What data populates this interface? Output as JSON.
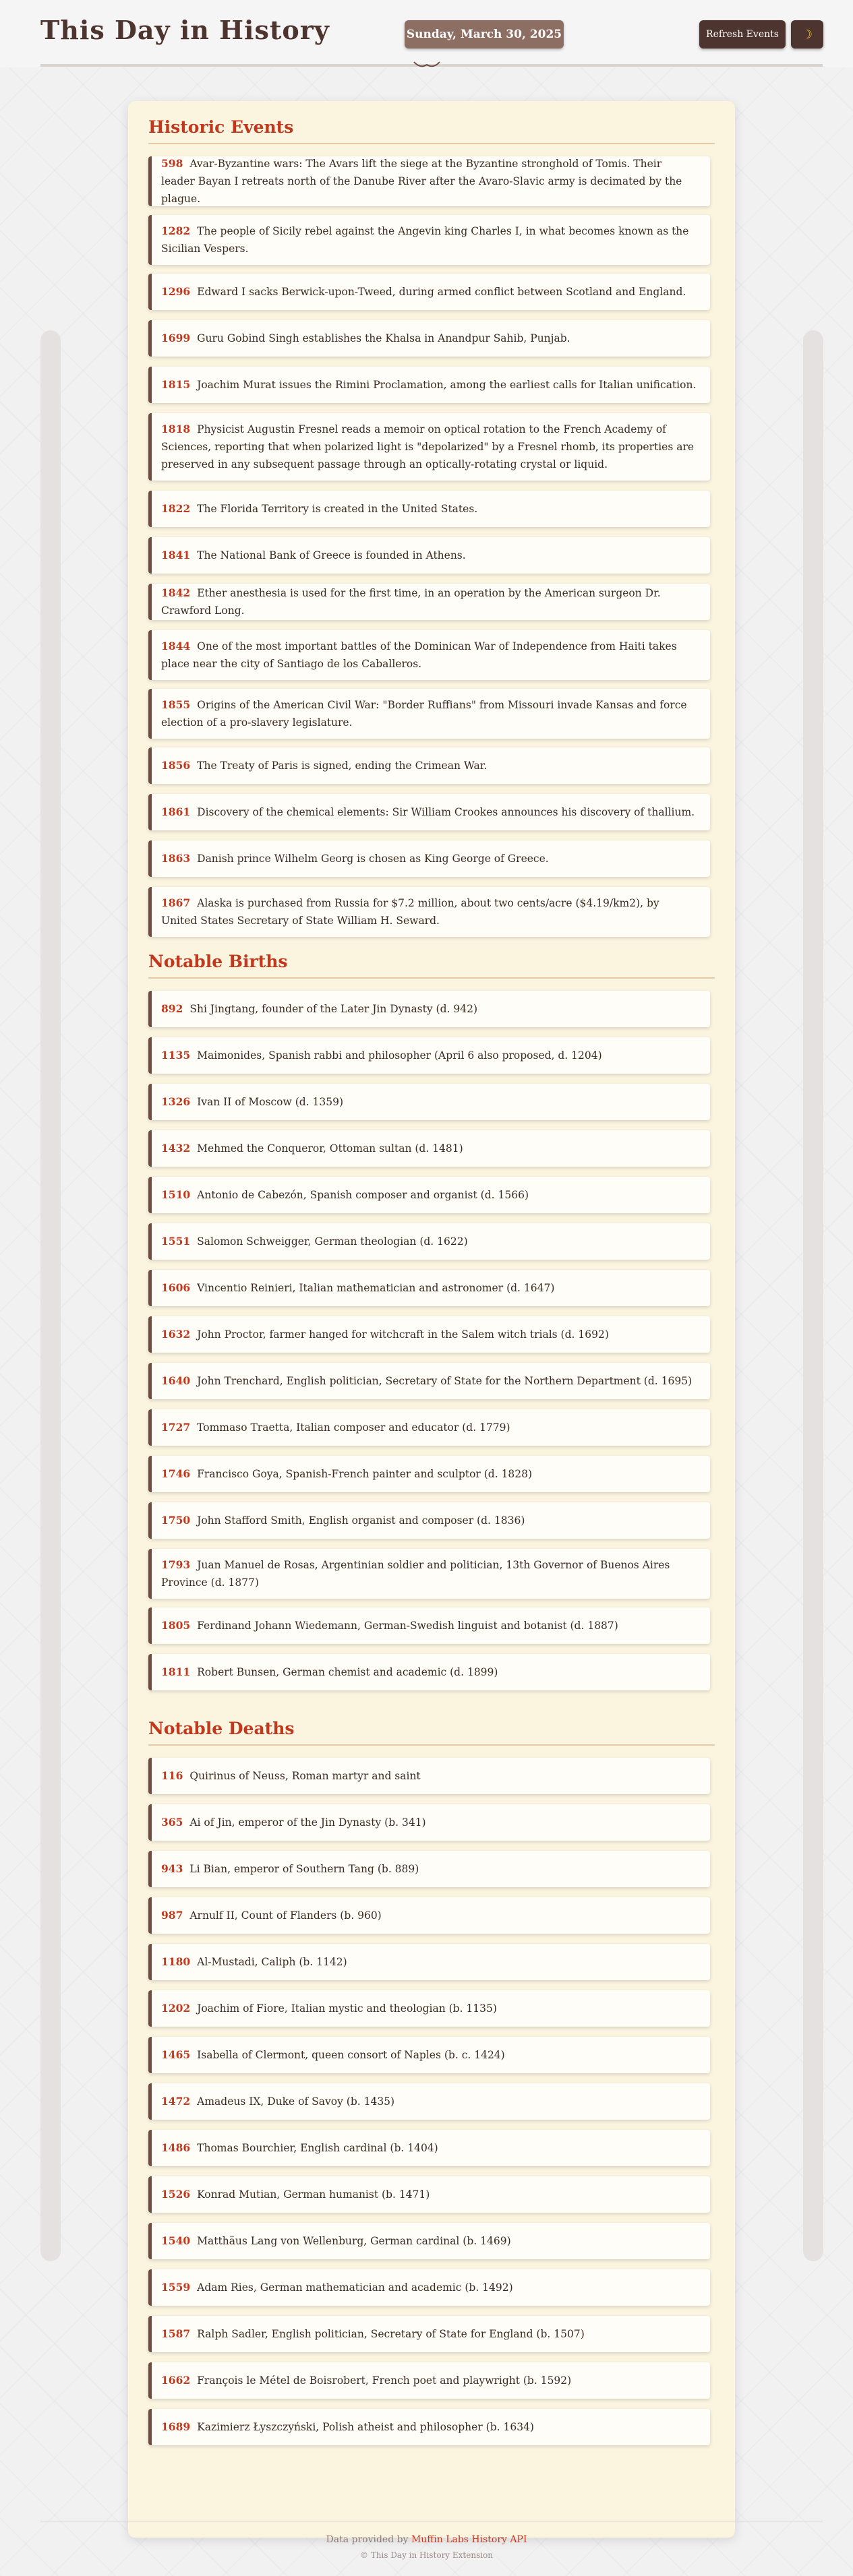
{
  "header": {
    "title": "This Day in History",
    "date": "Sunday, March 30, 2025",
    "refresh_label": "Refresh Events",
    "theme_icon": "moon-icon"
  },
  "sections": [
    {
      "title": "Historic Events",
      "items": [
        {
          "year": "598",
          "text": "Avar-Byzantine wars: The Avars lift the siege at the Byzantine stronghold of Tomis. Their leader Bayan I retreats north of the Danube River after the Avaro-Slavic army is decimated by the plague."
        },
        {
          "year": "1282",
          "text": "The people of Sicily rebel against the Angevin king Charles I, in what becomes known as the Sicilian Vespers."
        },
        {
          "year": "1296",
          "text": "Edward I sacks Berwick-upon-Tweed, during armed conflict between Scotland and England."
        },
        {
          "year": "1699",
          "text": "Guru Gobind Singh establishes the Khalsa in Anandpur Sahib, Punjab."
        },
        {
          "year": "1815",
          "text": "Joachim Murat issues the Rimini Proclamation, among the earliest calls for Italian unification."
        },
        {
          "year": "1818",
          "text": "Physicist Augustin Fresnel reads a memoir on optical rotation to the French Academy of Sciences, reporting that when polarized light is \"depolarized\" by a Fresnel rhomb, its properties are preserved in any subsequent passage through an optically-rotating crystal or liquid."
        },
        {
          "year": "1822",
          "text": "The Florida Territory is created in the United States."
        },
        {
          "year": "1841",
          "text": "The National Bank of Greece is founded in Athens."
        },
        {
          "year": "1842",
          "text": "Ether anesthesia is used for the first time, in an operation by the American surgeon Dr. Crawford Long."
        },
        {
          "year": "1844",
          "text": "One of the most important battles of the Dominican War of Independence from Haiti takes place near the city of Santiago de los Caballeros."
        },
        {
          "year": "1855",
          "text": "Origins of the American Civil War: \"Border Ruffians\" from Missouri invade Kansas and force election of a pro-slavery legislature."
        },
        {
          "year": "1856",
          "text": "The Treaty of Paris is signed, ending the Crimean War."
        },
        {
          "year": "1861",
          "text": "Discovery of the chemical elements: Sir William Crookes announces his discovery of thallium."
        },
        {
          "year": "1863",
          "text": "Danish prince Wilhelm Georg is chosen as King George of Greece."
        },
        {
          "year": "1867",
          "text": "Alaska is purchased from Russia for $7.2 million, about two cents/acre ($4.19/km2), by United States Secretary of State William H. Seward."
        }
      ]
    },
    {
      "title": "Notable Births",
      "items": [
        {
          "year": "892",
          "text": "Shi Jingtang, founder of the Later Jin Dynasty (d. 942)"
        },
        {
          "year": "1135",
          "text": "Maimonides, Spanish rabbi and philosopher (April 6 also proposed, d. 1204)"
        },
        {
          "year": "1326",
          "text": "Ivan II of Moscow (d. 1359)"
        },
        {
          "year": "1432",
          "text": "Mehmed the Conqueror, Ottoman sultan (d. 1481)"
        },
        {
          "year": "1510",
          "text": "Antonio de Cabezón, Spanish composer and organist (d. 1566)"
        },
        {
          "year": "1551",
          "text": "Salomon Schweigger, German theologian (d. 1622)"
        },
        {
          "year": "1606",
          "text": "Vincentio Reinieri, Italian mathematician and astronomer (d. 1647)"
        },
        {
          "year": "1632",
          "text": "John Proctor, farmer hanged for witchcraft in the Salem witch trials (d. 1692)"
        },
        {
          "year": "1640",
          "text": "John Trenchard, English politician, Secretary of State for the Northern Department (d. 1695)"
        },
        {
          "year": "1727",
          "text": "Tommaso Traetta, Italian composer and educator (d. 1779)"
        },
        {
          "year": "1746",
          "text": "Francisco Goya, Spanish-French painter and sculptor (d. 1828)"
        },
        {
          "year": "1750",
          "text": "John Stafford Smith, English organist and composer (d. 1836)"
        },
        {
          "year": "1793",
          "text": "Juan Manuel de Rosas, Argentinian soldier and politician, 13th Governor of Buenos Aires Province (d. 1877)"
        },
        {
          "year": "1805",
          "text": "Ferdinand Johann Wiedemann, German-Swedish linguist and botanist (d. 1887)"
        },
        {
          "year": "1811",
          "text": "Robert Bunsen, German chemist and academic (d. 1899)"
        }
      ]
    },
    {
      "title": "Notable Deaths",
      "items": [
        {
          "year": "116",
          "text": "Quirinus of Neuss, Roman martyr and saint"
        },
        {
          "year": "365",
          "text": "Ai of Jin, emperor of the Jin Dynasty (b. 341)"
        },
        {
          "year": "943",
          "text": "Li Bian, emperor of Southern Tang (b. 889)"
        },
        {
          "year": "987",
          "text": "Arnulf II, Count of Flanders (b. 960)"
        },
        {
          "year": "1180",
          "text": "Al-Mustadi, Caliph (b. 1142)"
        },
        {
          "year": "1202",
          "text": "Joachim of Fiore, Italian mystic and theologian (b. 1135)"
        },
        {
          "year": "1465",
          "text": "Isabella of Clermont, queen consort of Naples (b. c. 1424)"
        },
        {
          "year": "1472",
          "text": "Amadeus IX, Duke of Savoy (b. 1435)"
        },
        {
          "year": "1486",
          "text": "Thomas Bourchier, English cardinal (b. 1404)"
        },
        {
          "year": "1526",
          "text": "Konrad Mutian, German humanist (b. 1471)"
        },
        {
          "year": "1540",
          "text": "Matthäus Lang von Wellenburg, German cardinal (b. 1469)"
        },
        {
          "year": "1559",
          "text": "Adam Ries, German mathematician and academic (b. 1492)"
        },
        {
          "year": "1587",
          "text": "Ralph Sadler, English politician, Secretary of State for England (b. 1507)"
        },
        {
          "year": "1662",
          "text": "François le Métel de Boisrobert, French poet and playwright (b. 1592)"
        },
        {
          "year": "1689",
          "text": "Kazimierz Łyszczyński, Polish atheist and philosopher (b. 1634)"
        }
      ]
    }
  ],
  "footer": {
    "credit_prefix": "Data provided by",
    "credit_link": "Muffin Labs History API",
    "copyright": "© This Day in History Extension"
  }
}
